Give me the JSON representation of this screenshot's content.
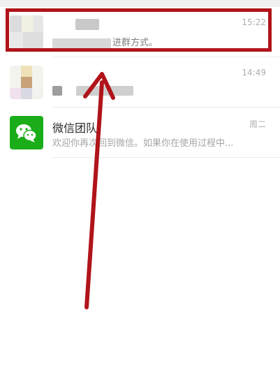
{
  "chats": [
    {
      "time": "15:22",
      "preview_suffix": "进群方式。",
      "avatar_icon": "mosaic-avatar"
    },
    {
      "time": "14:49",
      "avatar_icon": "mosaic-avatar"
    },
    {
      "name": "微信团队",
      "time": "周二",
      "preview": "欢迎你再次回到微信。如果你在使用过程中...",
      "avatar_icon": "wechat-logo-icon"
    }
  ],
  "colors": {
    "highlight_border": "#b0141a",
    "arrow": "#b0141a",
    "wechat_green": "#1aad19"
  }
}
